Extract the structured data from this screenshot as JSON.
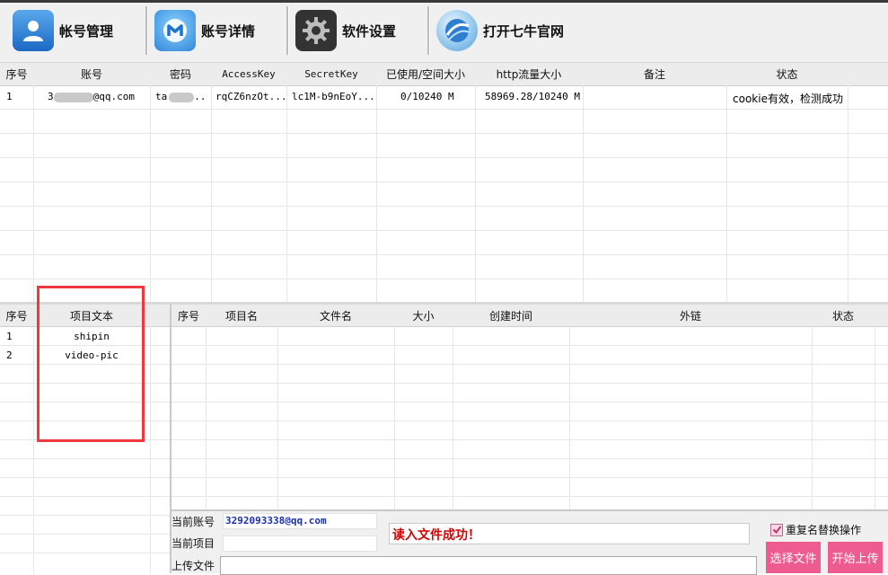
{
  "toolbar": {
    "buttons": [
      {
        "label": "帐号管理",
        "icon": "user-icon"
      },
      {
        "label": "账号详情",
        "icon": "browser-icon"
      },
      {
        "label": "软件设置",
        "icon": "gear-icon"
      },
      {
        "label": "打开七牛官网",
        "icon": "globe-icon"
      }
    ]
  },
  "account_table": {
    "headers": [
      "序号",
      "账号",
      "密码",
      "AccessKey",
      "SecretKey",
      "已使用/空间大小",
      "http流量大小",
      "备注",
      "状态"
    ],
    "rows": [
      {
        "index": "1",
        "account_prefix": "3",
        "account_suffix": "@qq.com",
        "password": "ta",
        "password_suffix": "..",
        "access_key": "rqCZ6nzOt...",
        "secret_key": "lc1M-b9nEoY...",
        "usage": "0/10240 M",
        "traffic": "58969.28/10240 M",
        "note": "",
        "status": "cookie有效，检测成功"
      }
    ]
  },
  "project_table": {
    "headers": [
      "序号",
      "项目文本"
    ],
    "rows": [
      {
        "index": "1",
        "name": "shipin"
      },
      {
        "index": "2",
        "name": "video-pic"
      }
    ]
  },
  "file_table": {
    "headers": [
      "序号",
      "项目名",
      "文件名",
      "大小",
      "创建时间",
      "外链",
      "状态"
    ],
    "rows": []
  },
  "bottom": {
    "current_account_label": "当前账号",
    "current_account_value": "3292093338@qq.com",
    "current_project_label": "当前项目",
    "current_project_value": "",
    "upload_file_label": "上传文件",
    "upload_file_value": "",
    "status_message": "读入文件成功！",
    "overwrite_label": "重复名替换操作",
    "overwrite_checked": true,
    "select_file_button": "选择文件",
    "start_upload_button": "开始上传"
  },
  "colors": {
    "highlight_box": "#f0393e",
    "status_text": "#d40000",
    "account_text": "#1a2fb0",
    "button_pink": "#ee5b8e"
  }
}
